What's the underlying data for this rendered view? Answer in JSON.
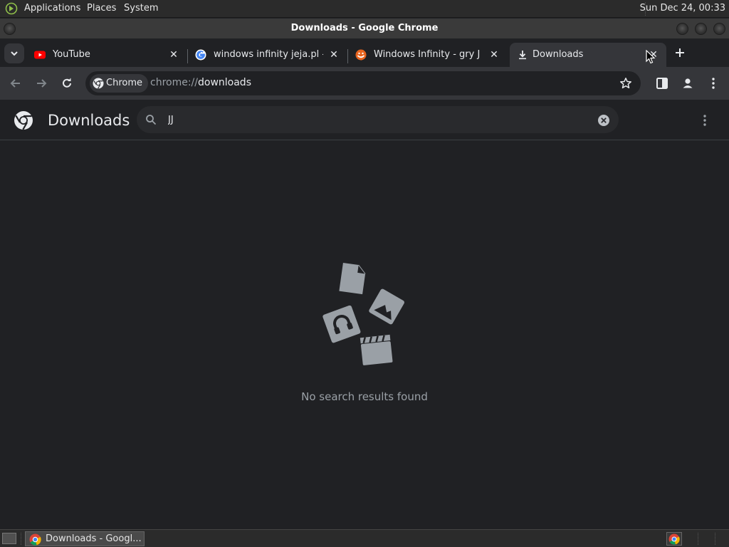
{
  "desktop": {
    "menu": [
      "Applications",
      "Places",
      "System"
    ],
    "clock": "Sun Dec 24, 00:33"
  },
  "window": {
    "title": "Downloads - Google Chrome"
  },
  "tabs": [
    {
      "title": "YouTube",
      "favicon": "youtube-icon",
      "active": false
    },
    {
      "title": "windows infinity jeja.pl - Go",
      "favicon": "google-icon",
      "active": false
    },
    {
      "title": "Windows Infinity - gry Jeja",
      "favicon": "jeja-icon",
      "active": false
    },
    {
      "title": "Downloads",
      "favicon": "download-icon",
      "active": true
    }
  ],
  "omnibox": {
    "chip_label": "Chrome",
    "url_scheme": "chrome://",
    "url_host": "downloads"
  },
  "downloads_page": {
    "title": "Downloads",
    "search_value": "JJ",
    "empty_message": "No search results found"
  },
  "taskbar": {
    "item_label": "Downloads - Googl..."
  },
  "colors": {
    "page_bg": "#202124",
    "toolbar_bg": "#35363a",
    "text_primary": "#e8eaed",
    "text_secondary": "#9aa0a6",
    "youtube_red": "#ff0000"
  }
}
